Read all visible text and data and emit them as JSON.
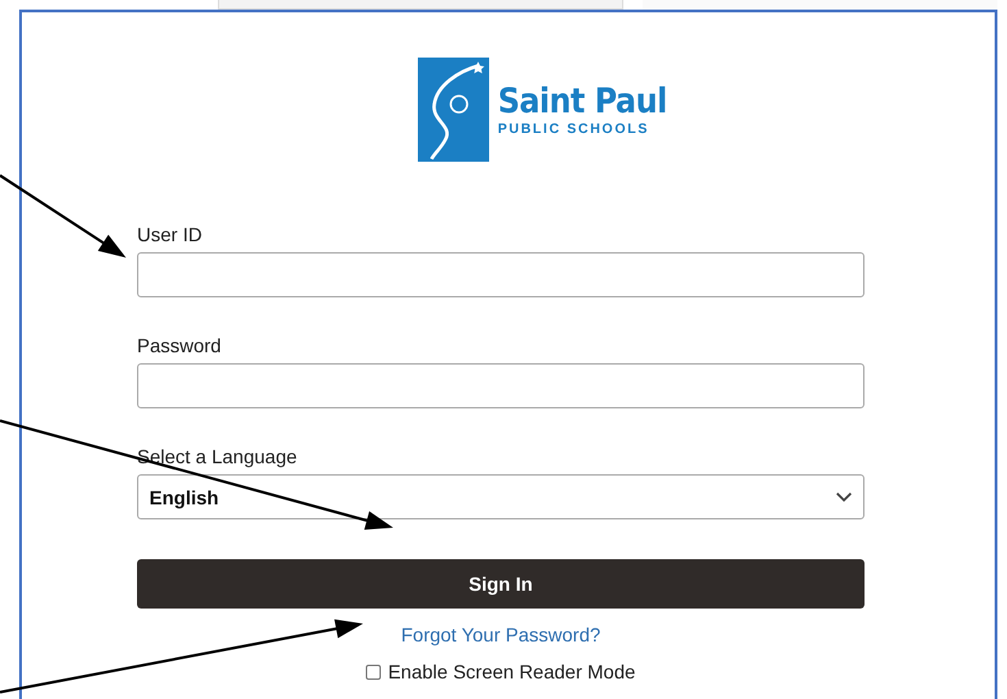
{
  "logo": {
    "title": "Saint Paul",
    "subtitle": "PUBLIC SCHOOLS"
  },
  "fields": [
    {
      "label": "User ID",
      "kind": "text"
    },
    {
      "label": "Password",
      "kind": "password"
    },
    {
      "label": "Select a Language",
      "kind": "select",
      "value": "English"
    }
  ],
  "sign_in_button": "Sign In",
  "forgot_link": "Forgot Your Password?",
  "screen_reader": {
    "label": "Enable Screen Reader Mode",
    "checked": false
  }
}
